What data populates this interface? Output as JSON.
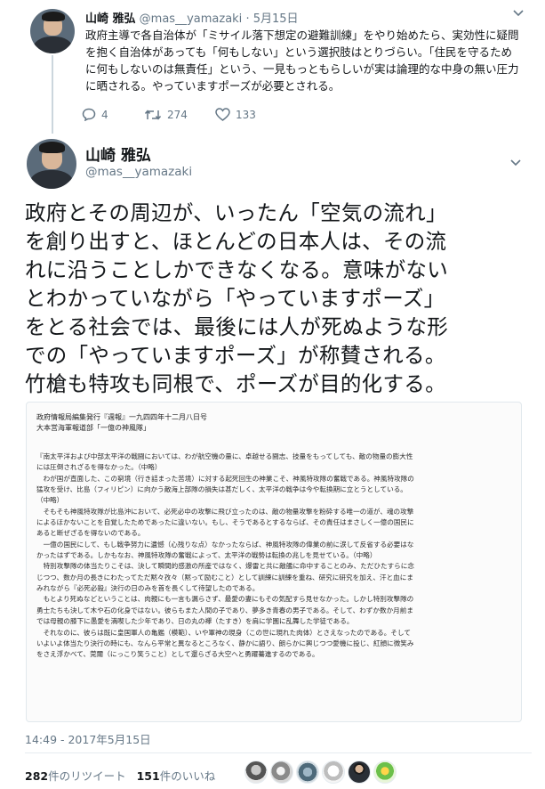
{
  "parent_tweet": {
    "name": "山崎 雅弘",
    "handle": "@mas__yamazaki",
    "date": "5月15日",
    "separator": "·",
    "text": "政府主導で各自治体が「ミサイル落下想定の避難訓練」をやり始めたら、実効性に疑問を抱く自治体があっても「何もしない」という選択肢はとりづらい。「住民を守るために何もしないのは無責任」という、一見もっともらしいが実は論理的な中身の無い圧力に晒される。やっていますポーズが必要とされる。",
    "reply_count": "4",
    "retweet_count": "274",
    "like_count": "133",
    "reply_icon": "reply-icon",
    "retweet_icon": "retweet-icon",
    "like_icon": "heart-icon"
  },
  "main_tweet": {
    "name": "山崎 雅弘",
    "handle": "@mas__yamazaki",
    "lines": [
      "政府とその周辺が、いったん「空気の流れ」",
      "を創り出すと、ほとんどの日本人は、その流",
      "れに沿うことしかできなくなる。意味がない",
      "とわかっていながら「やっていますポーズ」",
      "をとる社会では、最後には人が死ぬような形",
      "での「やっていますポーズ」が称賛される。",
      "竹槍も特攻も同根で、ポーズが目的化する。"
    ]
  },
  "document": {
    "header_1": "政府情報局編集発行『週報』一九四四年十二月八日号",
    "header_2": "大本営海軍報道部「一億の神風隊」",
    "lines": [
      "『南太平洋および中部太平洋の戦闘においては、わが航空機の量に、卓越せる闘志、技量をもってしても、敵の物量の膨大性",
      "には圧倒されざるを得なかった。（中略）",
      "　わが国が直面した、この窮境（行き詰まった苦境）に対する起死回生の神業こそ、神風特攻隊の奮戦である。神風特攻隊の",
      "猛攻を受け、比島（フィリピン）に向かう敵海上部隊の損失は甚だしく、太平洋の戦争は今や転換期に立とうとしている。",
      "（中略）",
      "　そもそも神風特攻隊が比島沖において、必死必中の攻撃に飛び立ったのは、敵の物量攻撃を粉砕する唯一の道が、魂の攻撃",
      "によるほかないことを自覚したためであったに違いない。もし、そうであるとするならば、その責任はまさしく一億の国民に",
      "あると断ぜざるを得ないのである。",
      "　一億の国民にして、もし戦争努力に遺憾（心残りな点）なかったならば、神風特攻隊の偉業の前に涙して反省する必要はな",
      "かったはずである。しかもなお、神風特攻隊の奮戦によって、太平洋の戦勢は転換の兆しを見せている。（中略）",
      "　特別攻撃隊の体当たりこそは、決して瞬間的感激の所産ではなく、爆雷と共に敵艦に命中することのみ、ただひたすらに念",
      "じつつ、数か月の長きにわたってただ黙々孜々（黙って励むこと）として訓練に訓練を重ね、研究に研究を加え、汗と血にま",
      "みれながら『必死必殺』決行の日のみを首を長くして待望したのである。",
      "　もとより死ぬなどということは、肉親にも一言も漏らさず、最愛の妻にもその気配すら見せなかった。しかし特別攻撃隊の",
      "勇士たちも決して木や石の化身ではない。彼らもまた人間の子であり、夢多き青春の男子である。そして、わずか数か月前ま",
      "では母親の膝下に愚愛を満喫した少年であり、日の丸の襷（たすき）を肩に学園に乱舞した学徒である。",
      "　それなのに、彼らは既に皇国軍人の亀鑑（模範）、いや軍神の現身（この世に現れた肉体）とさえなったのである。そして",
      "いよいよ体当たり決行の時にも、なんら平常と異なるところなく、静かに語り、朗らかに興じつつ愛機に投じ、紅顔に微笑み",
      "をさえ浮かべて、莞爾（にっこり笑うこと）として還らざる大空へと勇躍驀進するのである。"
    ]
  },
  "footer": {
    "timestamp": "14:49 - 2017年5月15日",
    "retweets_count": "282",
    "retweets_label": "件のリツイート",
    "likes_count": "151",
    "likes_label": "件のいいね"
  },
  "colors": {
    "text": "#14171a",
    "secondary": "#657786",
    "divider": "#e6ecf0"
  }
}
